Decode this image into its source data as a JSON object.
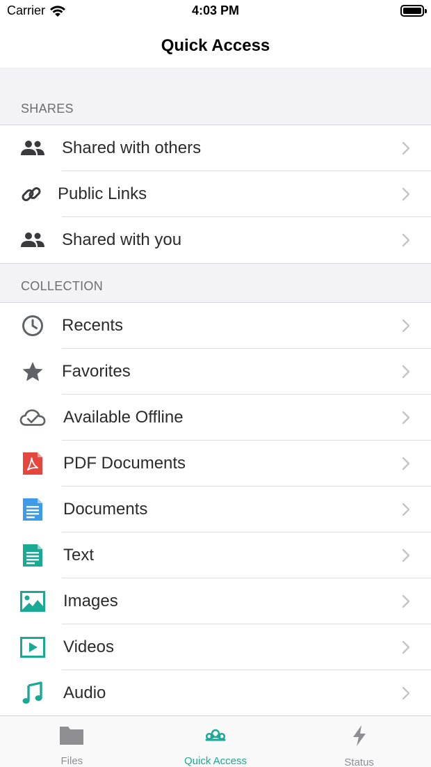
{
  "status_bar": {
    "carrier": "Carrier",
    "time": "4:03 PM",
    "battery_level": 1.0
  },
  "nav": {
    "title": "Quick Access"
  },
  "sections": {
    "shares": {
      "header": "SHARES",
      "items": [
        {
          "label": "Shared with others",
          "icon": "people-icon"
        },
        {
          "label": "Public Links",
          "icon": "link-icon"
        },
        {
          "label": "Shared with you",
          "icon": "people-icon"
        }
      ]
    },
    "collection": {
      "header": "COLLECTION",
      "items": [
        {
          "label": "Recents",
          "icon": "clock-icon"
        },
        {
          "label": "Favorites",
          "icon": "star-icon"
        },
        {
          "label": "Available Offline",
          "icon": "cloud-check-icon"
        },
        {
          "label": "PDF Documents",
          "icon": "pdf-icon"
        },
        {
          "label": "Documents",
          "icon": "document-icon"
        },
        {
          "label": "Text",
          "icon": "text-file-icon"
        },
        {
          "label": "Images",
          "icon": "image-icon"
        },
        {
          "label": "Videos",
          "icon": "video-icon"
        },
        {
          "label": "Audio",
          "icon": "music-note-icon"
        }
      ]
    }
  },
  "tab_bar": {
    "tabs": [
      {
        "label": "Files",
        "icon": "folder-icon",
        "active": false
      },
      {
        "label": "Quick Access",
        "icon": "cloud-icon",
        "active": true
      },
      {
        "label": "Status",
        "icon": "bolt-icon",
        "active": false
      }
    ]
  },
  "colors": {
    "accent": "#1aa994",
    "pdf_red": "#e5473e",
    "document_blue": "#3d9be9",
    "icon_gray": "#5f6368"
  }
}
